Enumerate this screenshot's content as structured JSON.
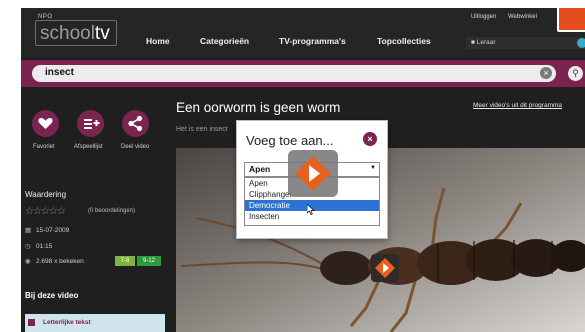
{
  "header": {
    "logo_small": "NPO",
    "logo_part1": "school",
    "logo_part2": "tv",
    "nav": [
      "Home",
      "Categorieën",
      "TV-programma's",
      "Topcollecties"
    ],
    "top_links": [
      "Uitloggen",
      "Webwinkel"
    ],
    "user_label": "Leraar"
  },
  "search": {
    "value": "insect"
  },
  "actions": [
    {
      "label": "Favoriet",
      "icon": "heart-icon"
    },
    {
      "label": "Afspeellijst",
      "icon": "playlist-add-icon"
    },
    {
      "label": "Deel video",
      "icon": "share-icon"
    }
  ],
  "sidebar": {
    "rating_title": "Waardering",
    "stars": "☆☆☆☆☆",
    "reviews": "(0 beoordelingen)",
    "date": "15-07-2009",
    "duration": "01:15",
    "views": "2.698 x bekeken",
    "grades": [
      "7-8",
      "9-12"
    ],
    "section_title": "Bij deze video",
    "literal_text_link": "Letterlijke tekst"
  },
  "video": {
    "title": "Een oorworm is geen worm",
    "subtitle": "Het is een insect",
    "more_link": "Meer video's uit dit programma"
  },
  "dialog": {
    "title": "Voeg toe aan...",
    "selected": "Apen",
    "options": [
      "Apen",
      "Clipphanger",
      "Democratie",
      "Insecten"
    ],
    "highlighted_index": 2
  },
  "colors": {
    "brand": "#7b2450",
    "header_bg": "#252525",
    "accent_orange": "#e8601e",
    "selection_blue": "#2a73d4"
  }
}
